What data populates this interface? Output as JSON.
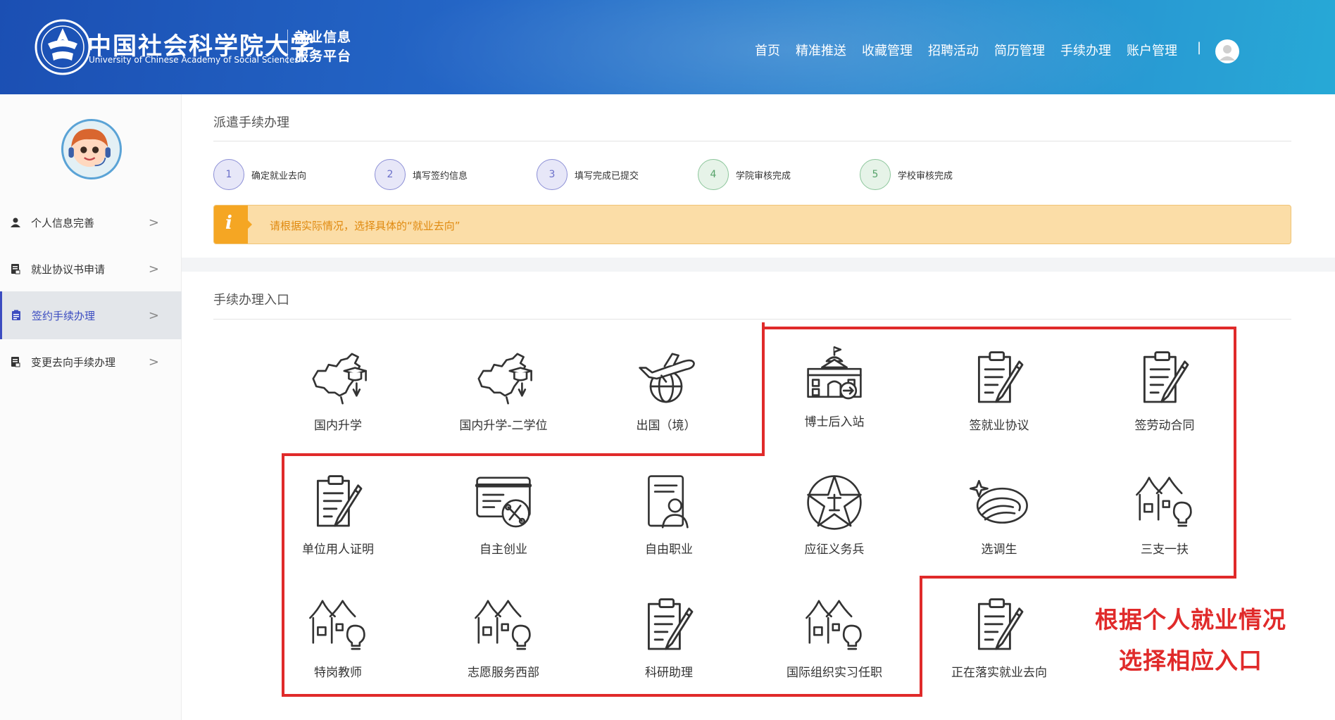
{
  "header": {
    "logo_cn": "中国社会科学院大学",
    "logo_en": "University of Chinese Academy of Social Sciences",
    "platform_line1": "就业信息",
    "platform_line2": "服务平台",
    "nav": [
      {
        "label": "首页"
      },
      {
        "label": "精准推送"
      },
      {
        "label": "收藏管理"
      },
      {
        "label": "招聘活动"
      },
      {
        "label": "简历管理"
      },
      {
        "label": "手续办理"
      },
      {
        "label": "账户管理"
      }
    ],
    "nav_separator": "|"
  },
  "sidebar": {
    "items": [
      {
        "label": "个人信息完善",
        "icon": "user-icon"
      },
      {
        "label": "就业协议书申请",
        "icon": "document-icon"
      },
      {
        "label": "签约手续办理",
        "icon": "clipboard-icon",
        "active": true
      },
      {
        "label": "变更去向手续办理",
        "icon": "document-icon"
      }
    ],
    "chevron": ">"
  },
  "dispatch": {
    "title": "派遣手续办理",
    "steps": [
      {
        "num": "1",
        "label": "确定就业去向",
        "state": "todo"
      },
      {
        "num": "2",
        "label": "填写签约信息",
        "state": "todo"
      },
      {
        "num": "3",
        "label": "填写完成已提交",
        "state": "todo"
      },
      {
        "num": "4",
        "label": "学院审核完成",
        "state": "done"
      },
      {
        "num": "5",
        "label": "学校审核完成",
        "state": "done"
      }
    ],
    "notice_icon": "i",
    "notice": "请根据实际情况，选择具体的“就业去向”"
  },
  "entries": {
    "title": "手续办理入口",
    "items": [
      {
        "label": "国内升学",
        "icon": "china-map-graduate-icon"
      },
      {
        "label": "国内升学-二学位",
        "icon": "china-map-graduate-icon"
      },
      {
        "label": "出国（境）",
        "icon": "airplane-globe-icon"
      },
      {
        "label": "博士后入站",
        "icon": "institute-building-icon"
      },
      {
        "label": "签就业协议",
        "icon": "clipboard-pen-icon"
      },
      {
        "label": "签劳动合同",
        "icon": "clipboard-pen-icon"
      },
      {
        "label": "单位用人证明",
        "icon": "clipboard-pen-icon"
      },
      {
        "label": "自主创业",
        "icon": "card-tools-icon"
      },
      {
        "label": "自由职业",
        "icon": "person-document-icon"
      },
      {
        "label": "应征义务兵",
        "icon": "army-star-icon"
      },
      {
        "label": "选调生",
        "icon": "ribbon-emblem-icon"
      },
      {
        "label": "三支一扶",
        "icon": "village-bulb-icon"
      },
      {
        "label": "特岗教师",
        "icon": "village-bulb-icon"
      },
      {
        "label": "志愿服务西部",
        "icon": "village-bulb-icon"
      },
      {
        "label": "科研助理",
        "icon": "clipboard-pen-icon"
      },
      {
        "label": "国际组织实习任职",
        "icon": "village-bulb-icon"
      },
      {
        "label": "正在落实就业去向",
        "icon": "clipboard-pen-icon"
      }
    ]
  },
  "annotation": {
    "line1": "根据个人就业情况",
    "line2": "选择相应入口",
    "color": "#e02a2a"
  }
}
